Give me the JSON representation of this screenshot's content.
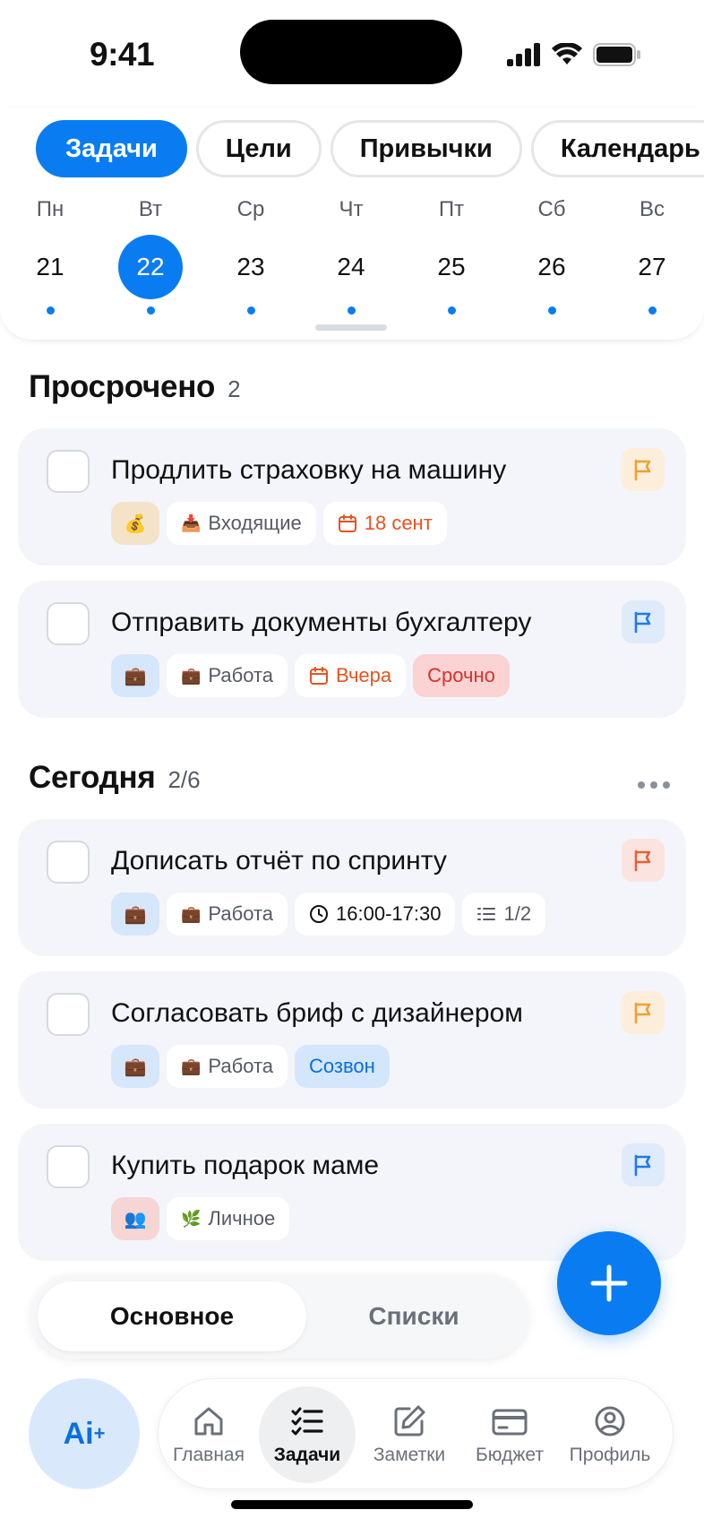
{
  "status_bar": {
    "time": "9:41"
  },
  "tabs": [
    {
      "label": "Задачи",
      "active": true
    },
    {
      "label": "Цели",
      "active": false
    },
    {
      "label": "Привычки",
      "active": false
    },
    {
      "label": "Календарь",
      "active": false
    }
  ],
  "week": [
    {
      "name": "Пн",
      "num": "21"
    },
    {
      "name": "Вт",
      "num": "22",
      "selected": true
    },
    {
      "name": "Ср",
      "num": "23"
    },
    {
      "name": "Чт",
      "num": "24"
    },
    {
      "name": "Пт",
      "num": "25"
    },
    {
      "name": "Сб",
      "num": "26"
    },
    {
      "name": "Вс",
      "num": "27"
    }
  ],
  "overdue": {
    "title": "Просрочено",
    "count": "2",
    "tasks": [
      {
        "title": "Продлить страховку на машину",
        "category_emoji": "💰",
        "list": "Входящие",
        "list_emoji": "📥",
        "date": "18 сент",
        "flag": "orange"
      },
      {
        "title": "Отправить документы бухгалтеру",
        "category_emoji": "💼",
        "list": "Работа",
        "list_emoji": "💼",
        "date": "Вчера",
        "tag": "Срочно",
        "flag": "blue"
      }
    ]
  },
  "today": {
    "title": "Сегодня",
    "count": "2/6",
    "tasks": [
      {
        "title": "Дописать отчёт по спринту",
        "category_emoji": "💼",
        "list": "Работа",
        "list_emoji": "💼",
        "time": "16:00-17:30",
        "subtasks": "1/2",
        "flag": "red"
      },
      {
        "title": "Согласовать бриф с дизайнером",
        "category_emoji": "💼",
        "list": "Работа",
        "list_emoji": "💼",
        "tag": "Созвон",
        "flag": "orange"
      },
      {
        "title": "Купить подарок маме",
        "category_emoji": "👥",
        "list": "Личное",
        "list_emoji": "🌿",
        "flag": "blue"
      }
    ]
  },
  "segment": {
    "primary": "Основное",
    "secondary": "Списки"
  },
  "ai_button": {
    "label": "Ai"
  },
  "nav": [
    {
      "label": "Главная",
      "icon": "home-icon"
    },
    {
      "label": "Задачи",
      "icon": "checklist-icon",
      "active": true
    },
    {
      "label": "Заметки",
      "icon": "edit-note-icon"
    },
    {
      "label": "Бюджет",
      "icon": "credit-card-icon"
    },
    {
      "label": "Профиль",
      "icon": "profile-icon"
    }
  ],
  "colors": {
    "accent": "#0a7cf2",
    "flag_orange": "#f0a030",
    "flag_blue": "#1f7be8",
    "flag_red": "#e8603a",
    "date_red": "#e8521f"
  }
}
